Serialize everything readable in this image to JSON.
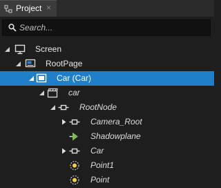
{
  "panel": {
    "tab_label": "Project",
    "tab_close_glyph": "×"
  },
  "search": {
    "placeholder": "Search...",
    "value": ""
  },
  "tree": [
    {
      "label": "Screen",
      "icon": "screen-icon",
      "italic": false,
      "expanded": true,
      "selected": false
    },
    {
      "label": "RootPage",
      "icon": "page-icon",
      "italic": false,
      "expanded": true,
      "selected": false
    },
    {
      "label": "Car (Car)",
      "icon": "viewport-icon",
      "italic": false,
      "expanded": true,
      "selected": true
    },
    {
      "label": "car",
      "icon": "scene-icon",
      "italic": true,
      "expanded": true,
      "selected": false
    },
    {
      "label": "RootNode",
      "icon": "empty-node-icon",
      "italic": true,
      "expanded": true,
      "selected": false
    },
    {
      "label": "Camera_Root",
      "icon": "empty-node-icon",
      "italic": true,
      "expanded": false,
      "selected": false
    },
    {
      "label": "Shadowplane",
      "icon": "mesh-node-icon",
      "italic": true,
      "expanded": null,
      "selected": false
    },
    {
      "label": "Car",
      "icon": "empty-node-icon",
      "italic": true,
      "expanded": false,
      "selected": false
    },
    {
      "label": "Point1",
      "icon": "point-light-icon",
      "italic": true,
      "expanded": null,
      "selected": false
    },
    {
      "label": "Point",
      "icon": "point-light-icon",
      "italic": true,
      "expanded": null,
      "selected": false
    }
  ],
  "colors": {
    "panel_background": "#1e1e1e",
    "selection": "#1f7fc9",
    "mesh_icon": "#7cc04a",
    "light_icon": "#f5d23a"
  }
}
